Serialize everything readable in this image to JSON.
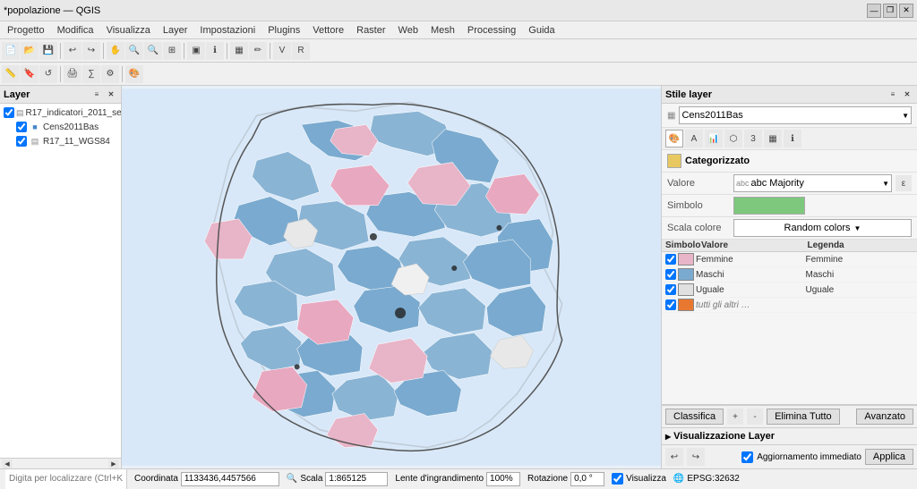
{
  "titlebar": {
    "title": "*popolazione — QGIS",
    "controls": [
      "—",
      "❐",
      "✕"
    ]
  },
  "menubar": {
    "items": [
      "Progetto",
      "Modifica",
      "Visualizza",
      "Layer",
      "Impostazioni",
      "Plugins",
      "Vettore",
      "Raster",
      "Web",
      "Mesh",
      "Processing",
      "Guida"
    ]
  },
  "layers": {
    "header": "Layer",
    "items": [
      {
        "name": "R17_indicatori_2011_se",
        "type": "vector",
        "checked": true,
        "indent": 0
      },
      {
        "name": "Cens2011Bas",
        "type": "raster",
        "checked": true,
        "indent": 1
      },
      {
        "name": "R17_11_WGS84",
        "type": "vector",
        "checked": true,
        "indent": 1
      }
    ]
  },
  "style_panel": {
    "header": "Stile layer",
    "layer_dropdown": "Cens2011Bas",
    "renderer_label": "Categorizzato",
    "value_label": "Valore",
    "value_field": "abc Majority",
    "symbol_label": "Simbolo",
    "color_scale_label": "Scala colore",
    "color_scale_value": "Random colors",
    "categories_header": {
      "symbol": "Simbolo",
      "value": "Valore",
      "legend": "Legenda"
    },
    "categories": [
      {
        "checked": true,
        "color": "#e8b4c8",
        "value": "Femmine",
        "legend": "Femmine"
      },
      {
        "checked": true,
        "color": "#88aacc",
        "value": "Maschi",
        "legend": "Maschi"
      },
      {
        "checked": true,
        "color": "#e8e8e8",
        "value": "Uguale",
        "legend": "Uguale"
      },
      {
        "checked": true,
        "color": "#e87830",
        "value": "tutti gli altri …",
        "legend": "",
        "italic": true
      }
    ],
    "footer_buttons": [
      "Classifica",
      "",
      "",
      "Elimina Tutto",
      "Avanzato"
    ],
    "vis_layer_label": "Visualizzazione Layer",
    "bottom_buttons": [
      "↩",
      "↪"
    ],
    "update_label": "Aggiornamento immediato",
    "apply_label": "Applica"
  },
  "statusbar": {
    "coordinate_label": "Coordinata",
    "coordinate_value": "1133436,4457566",
    "scale_label": "Scala",
    "scale_value": "1:865125",
    "magnifier_label": "Lente d'ingrandimento",
    "magnifier_value": "100%",
    "rotation_label": "Rotazione",
    "rotation_value": "0,0 °",
    "show_label": "Visualizza",
    "epsg_value": "EPSG:32632",
    "locate_placeholder": "Digita per localizzare (Ctrl+K)"
  }
}
